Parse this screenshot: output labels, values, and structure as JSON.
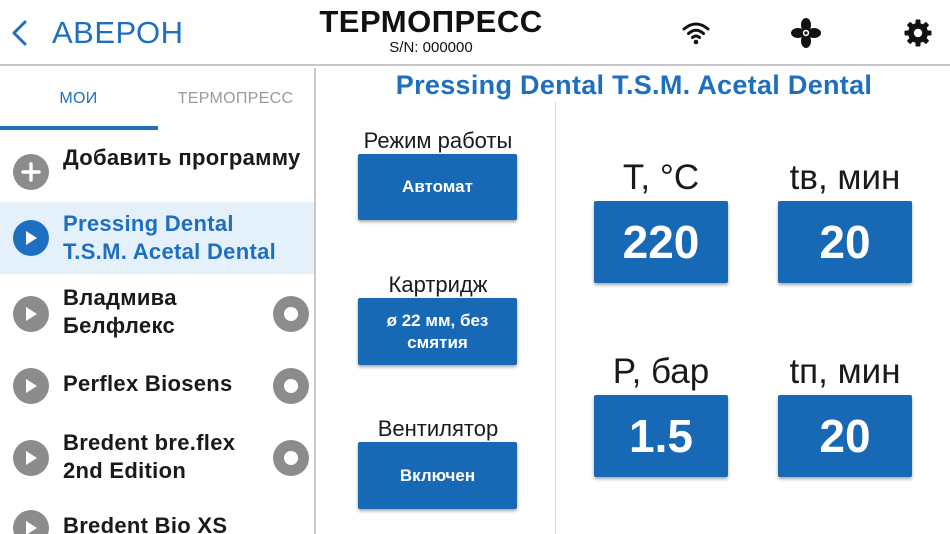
{
  "header": {
    "back_label": "АВЕРОН",
    "title": "ТЕРМОПРЕСС",
    "serial": "S/N: 000000",
    "icons": [
      "wifi-icon",
      "fan-icon",
      "gear-icon"
    ]
  },
  "tabs": [
    {
      "label": "МОИ",
      "active": true
    },
    {
      "label": "ТЕРМОПРЕСС",
      "active": false
    }
  ],
  "programs": [
    {
      "name": "Добавить программу",
      "icon": "plus-icon"
    },
    {
      "name": "Pressing Dental T.S.M. Acetal Dental",
      "icon": "play-icon",
      "selected": true
    },
    {
      "name": "Владмива Белфлекс",
      "icon": "play-icon"
    },
    {
      "name": "Perflex Biosens",
      "icon": "play-icon"
    },
    {
      "name": "Bredent bre.flex 2nd Edition",
      "icon": "play-icon"
    },
    {
      "name": "Bredent Bio XS",
      "icon": "play-icon"
    }
  ],
  "program_title": "Pressing Dental T.S.M. Acetal Dental",
  "settings": [
    {
      "label": "Режим работы",
      "value": "Автомат"
    },
    {
      "label": "Картридж",
      "value": "ø 22 мм, без смятия"
    },
    {
      "label": "Вентилятор",
      "value": "Включен"
    }
  ],
  "params": [
    {
      "label": "T, °C",
      "value": "220"
    },
    {
      "label": "tв, мин",
      "value": "20"
    },
    {
      "label": "P, бар",
      "value": "1.5"
    },
    {
      "label": "tп, мин",
      "value": "20"
    }
  ],
  "colors": {
    "accent": "#1f6fc0",
    "button": "#1768b5",
    "selected_row": "#e4f1fb",
    "icon_gray": "#8c8c8c"
  }
}
